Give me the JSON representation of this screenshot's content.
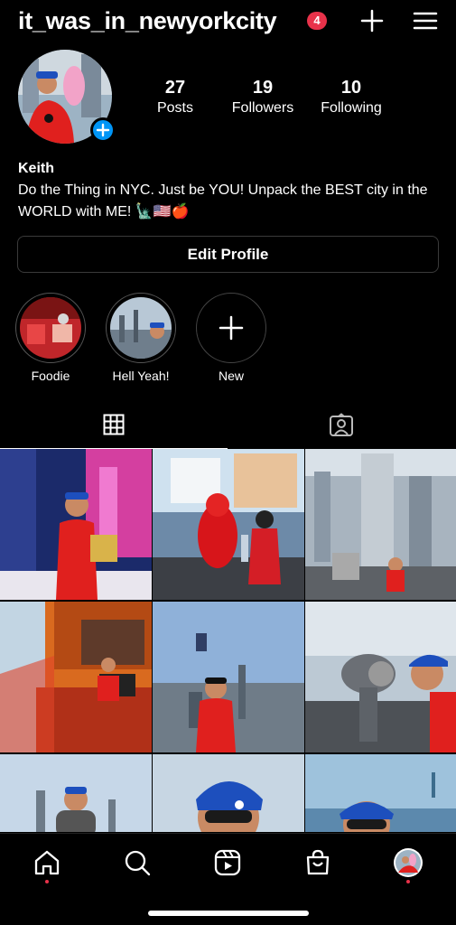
{
  "header": {
    "username": "it_was_in_newyorkcity",
    "notification_count": "4",
    "create_icon": "plus-icon",
    "menu_icon": "hamburger-menu-icon"
  },
  "profile": {
    "stats": [
      {
        "value": "27",
        "label": "Posts"
      },
      {
        "value": "19",
        "label": "Followers"
      },
      {
        "value": "10",
        "label": "Following"
      }
    ],
    "name": "Keith",
    "bio": "Do the Thing in NYC. Just be YOU! Unpack the BEST city in the WORLD with ME! 🗽🇺🇸🍎",
    "edit_button_label": "Edit Profile"
  },
  "highlights": [
    {
      "label": "Foodie"
    },
    {
      "label": "Hell Yeah!"
    },
    {
      "label": "New"
    }
  ],
  "tabs": [
    {
      "icon": "grid-icon",
      "active": true
    },
    {
      "icon": "tagged-person-icon",
      "active": false
    }
  ],
  "bottom_nav": [
    {
      "icon": "home-icon",
      "active": true
    },
    {
      "icon": "search-icon",
      "active": false
    },
    {
      "icon": "reels-icon",
      "active": false
    },
    {
      "icon": "shop-bag-icon",
      "active": false
    },
    {
      "icon": "profile-avatar-icon",
      "active": false
    }
  ],
  "colors": {
    "background": "#000000",
    "badge": "#e8324a",
    "accent_blue": "#0095f6"
  }
}
